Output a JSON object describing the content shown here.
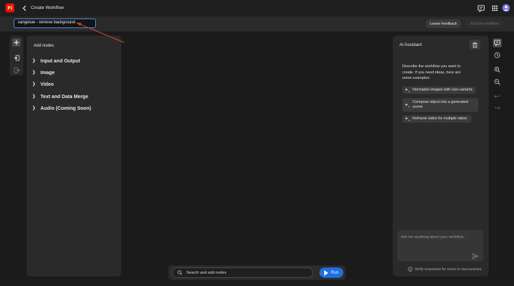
{
  "header": {
    "logo_text": "Fi",
    "title": "Create Workflow",
    "brand_color": "#eb1000"
  },
  "toolbar": {
    "workflow_name": "vangeluw - remove background",
    "leave_feedback": "Leave feedback",
    "publish": "Publish workflow"
  },
  "nodes_panel": {
    "title": "Add nodes",
    "items": [
      {
        "label": "Input and Output"
      },
      {
        "label": "Image"
      },
      {
        "label": "Video"
      },
      {
        "label": "Text and Data Merge"
      },
      {
        "label": "Audio (Coming Soon)"
      }
    ]
  },
  "ai_panel": {
    "title": "AI Assistant",
    "intro": "Describe the workflow you want to create. If you need ideas, here are some examples:",
    "suggestions": [
      {
        "label": "Normalize images with size variants"
      },
      {
        "label": "Compose object into a generated scene"
      },
      {
        "label": "Reframe video for multiple ratios"
      }
    ],
    "input_placeholder": "Ask me anything about your workflow...",
    "verify_note": "Verify responses for errors or inaccuracies."
  },
  "bottom_bar": {
    "search_placeholder": "Search and add nodes",
    "run_label": "Run",
    "accent_color": "#1f6fe0"
  }
}
